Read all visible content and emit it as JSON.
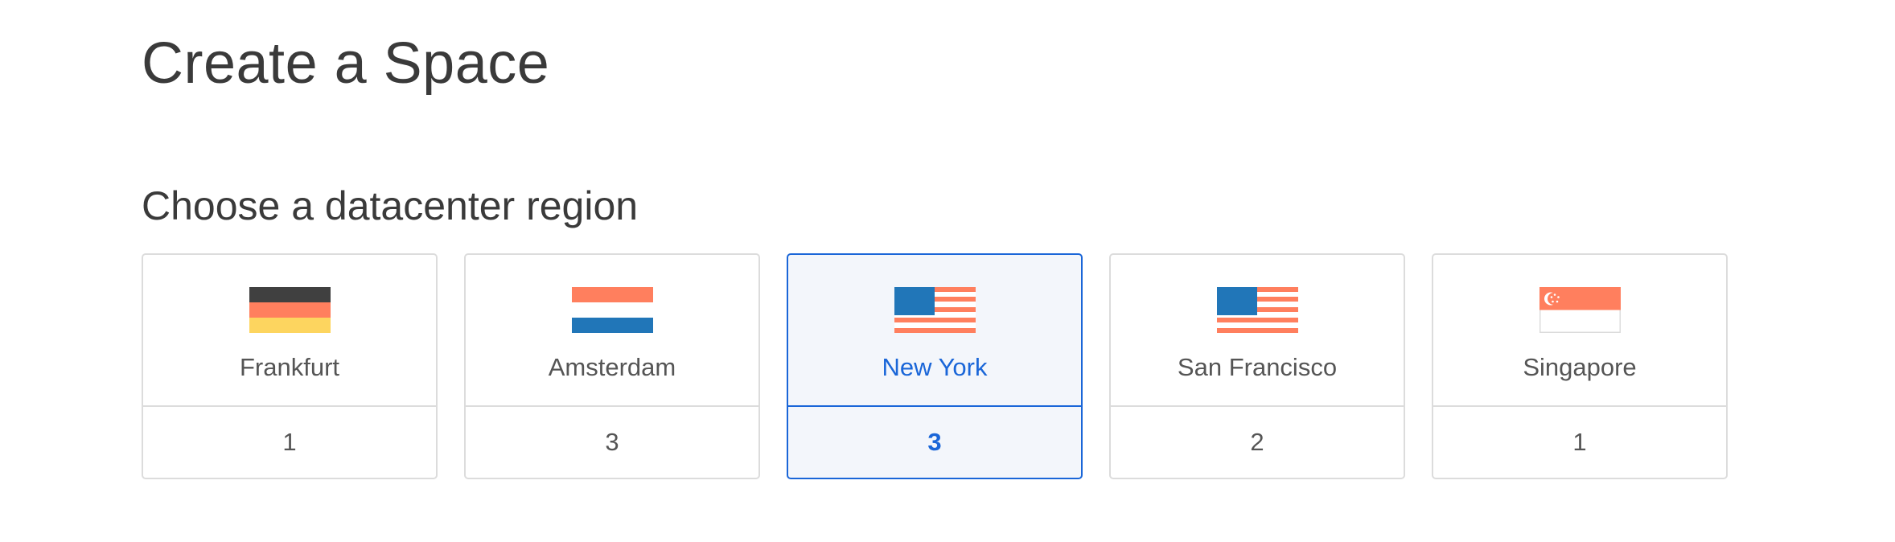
{
  "page": {
    "title": "Create a Space"
  },
  "section": {
    "title": "Choose a datacenter region"
  },
  "colors": {
    "accent": "#1a66d8",
    "selected_bg": "#f3f6fb",
    "border": "#dcdcdc",
    "flag_orange": "#ff7f5e",
    "flag_blue": "#2176b8",
    "flag_dark": "#404040",
    "flag_yellow": "#fdd55f"
  },
  "regions": [
    {
      "name": "Frankfurt",
      "count": "1",
      "flag": "germany-flag-icon",
      "selected": false
    },
    {
      "name": "Amsterdam",
      "count": "3",
      "flag": "netherlands-flag-icon",
      "selected": false
    },
    {
      "name": "New York",
      "count": "3",
      "flag": "usa-flag-icon",
      "selected": true
    },
    {
      "name": "San Francisco",
      "count": "2",
      "flag": "usa-flag-icon",
      "selected": false
    },
    {
      "name": "Singapore",
      "count": "1",
      "flag": "singapore-flag-icon",
      "selected": false
    }
  ]
}
